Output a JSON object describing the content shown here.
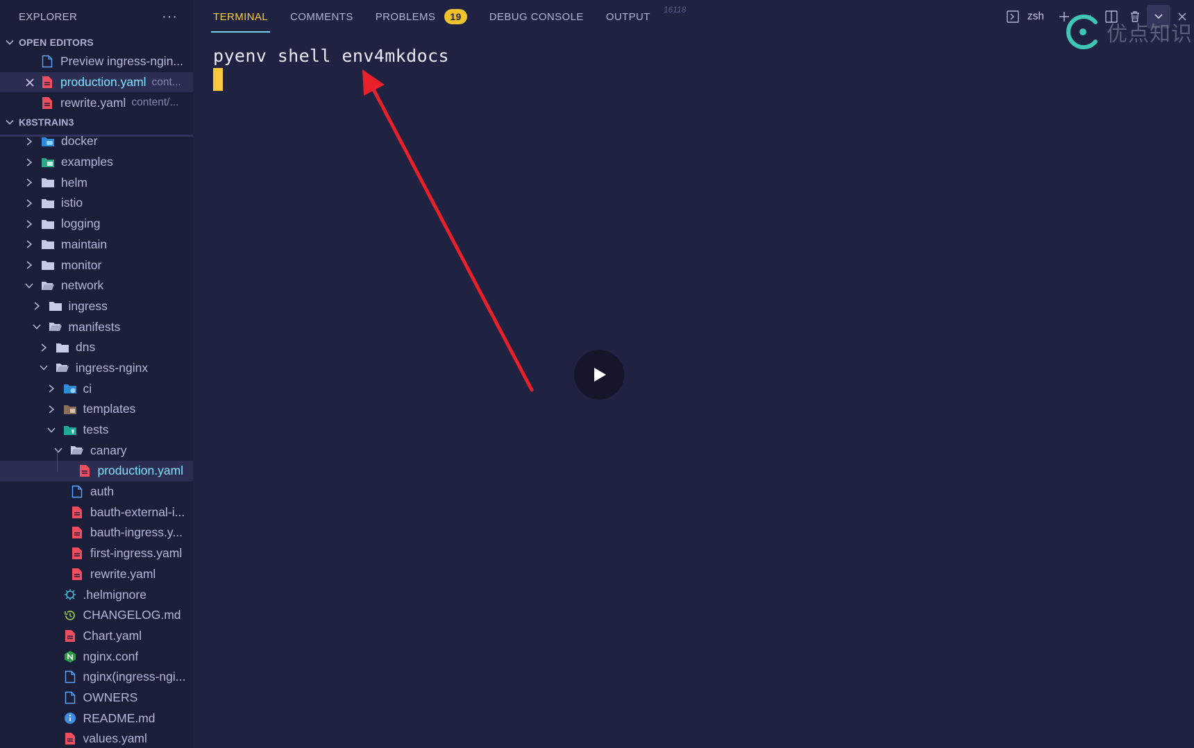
{
  "explorer": {
    "title": "EXPLORER",
    "more": "···",
    "open_editors_label": "OPEN EDITORS",
    "workspace_label": "K8STRAIN3",
    "open_editors": [
      {
        "name": "Preview ingress-ngin...",
        "icon": "file-preview-icon"
      },
      {
        "name": "production.yaml",
        "path": "cont...",
        "icon": "yaml-file-icon",
        "active": true
      },
      {
        "name": "rewrite.yaml",
        "path": "content/...",
        "icon": "yaml-file-icon"
      }
    ],
    "tree": [
      {
        "name": "docker",
        "icon": "docker-folder-icon"
      },
      {
        "name": "examples",
        "icon": "examples-folder-icon"
      },
      {
        "name": "helm",
        "icon": "folder-icon"
      },
      {
        "name": "istio",
        "icon": "folder-icon"
      },
      {
        "name": "logging",
        "icon": "folder-icon"
      },
      {
        "name": "maintain",
        "icon": "folder-icon"
      },
      {
        "name": "monitor",
        "icon": "folder-icon"
      },
      {
        "name": "network",
        "icon": "folder-open-icon"
      },
      {
        "name": "ingress",
        "icon": "folder-icon"
      },
      {
        "name": "manifests",
        "icon": "folder-open-icon"
      },
      {
        "name": "dns",
        "icon": "folder-icon"
      },
      {
        "name": "ingress-nginx",
        "icon": "folder-open-icon"
      },
      {
        "name": "ci",
        "icon": "ci-folder-icon"
      },
      {
        "name": "templates",
        "icon": "templates-folder-icon"
      },
      {
        "name": "tests",
        "icon": "tests-folder-icon"
      },
      {
        "name": "canary",
        "icon": "folder-open-icon"
      },
      {
        "name": "production.yaml",
        "icon": "yaml-file-icon",
        "active": true
      },
      {
        "name": "auth",
        "icon": "file-icon"
      },
      {
        "name": "bauth-external-i...",
        "icon": "yaml-file-icon"
      },
      {
        "name": "bauth-ingress.y...",
        "icon": "yaml-file-icon"
      },
      {
        "name": "first-ingress.yaml",
        "icon": "yaml-file-icon"
      },
      {
        "name": "rewrite.yaml",
        "icon": "yaml-file-icon"
      },
      {
        "name": ".helmignore",
        "icon": "helm-icon"
      },
      {
        "name": "CHANGELOG.md",
        "icon": "changelog-icon"
      },
      {
        "name": "Chart.yaml",
        "icon": "yaml-file-icon"
      },
      {
        "name": "nginx.conf",
        "icon": "nginx-icon"
      },
      {
        "name": "nginx(ingress-ngi...",
        "icon": "file-icon"
      },
      {
        "name": "OWNERS",
        "icon": "file-icon"
      },
      {
        "name": "README.md",
        "icon": "info-icon"
      },
      {
        "name": "values.yaml",
        "icon": "yaml-file-icon"
      }
    ]
  },
  "panel": {
    "tabs": [
      {
        "label": "TERMINAL",
        "active": true
      },
      {
        "label": "COMMENTS"
      },
      {
        "label": "PROBLEMS",
        "badge": "19"
      },
      {
        "label": "DEBUG CONSOLE"
      },
      {
        "label": "OUTPUT"
      }
    ],
    "faint_label": "16118",
    "shell": "zsh",
    "terminal_line": "pyenv shell env4mkdocs"
  },
  "watermark": {
    "text": "优点知识"
  },
  "colors": {
    "accent": "#ffc93d",
    "active_text": "#7fe3ff",
    "annotation_arrow": "#e8202a",
    "badge": "#f2c22c",
    "yaml_icon": "#f04e5e",
    "folder_icon": "#c8cbe6"
  }
}
